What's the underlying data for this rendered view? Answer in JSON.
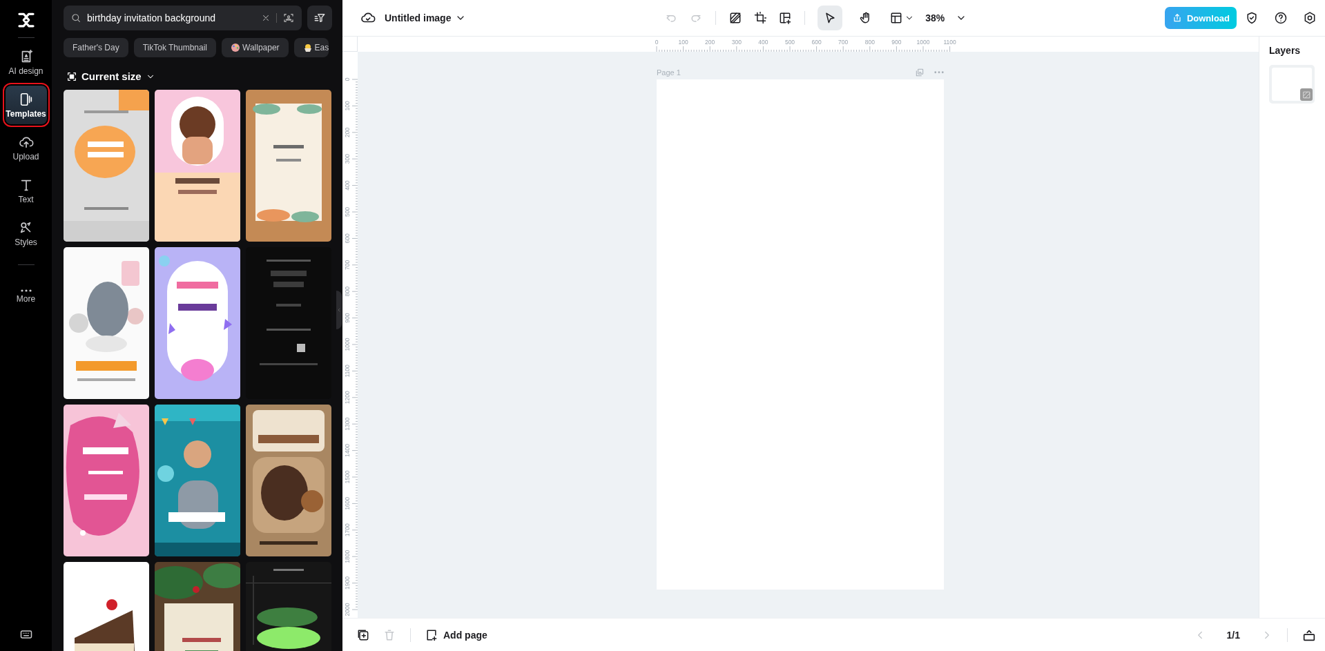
{
  "rail": {
    "items": [
      {
        "label": "AI design",
        "selected": false
      },
      {
        "label": "Templates",
        "selected": true
      },
      {
        "label": "Upload",
        "selected": false
      },
      {
        "label": "Text",
        "selected": false
      },
      {
        "label": "Styles",
        "selected": false
      },
      {
        "label": "More",
        "selected": false
      }
    ]
  },
  "search": {
    "value": "birthday invitation background"
  },
  "chips": [
    {
      "label": "Father's Day",
      "kind": "plain"
    },
    {
      "label": "TikTok Thumbnail",
      "kind": "plain"
    },
    {
      "label": "Wallpaper",
      "kind": "palette"
    },
    {
      "label": "Eas",
      "kind": "chick"
    }
  ],
  "section": {
    "title": "Current size"
  },
  "topbar": {
    "title": "Untitled image",
    "undo_disabled": true,
    "redo_disabled": true,
    "zoom": "38%",
    "download": "Download"
  },
  "tools": [
    {
      "kind": "select",
      "selected": true
    },
    {
      "kind": "hand",
      "selected": false
    }
  ],
  "ruler": {
    "x_labels": [
      "0",
      "100",
      "200",
      "300",
      "400",
      "500",
      "600",
      "700",
      "800",
      "900",
      "1000",
      "1100"
    ],
    "y_labels": [
      "0",
      "100",
      "200",
      "300",
      "400",
      "500",
      "600",
      "700",
      "800",
      "900",
      "1000",
      "1100",
      "1200",
      "1300",
      "1400",
      "1500",
      "1600",
      "1700",
      "1800",
      "1900",
      "2000"
    ]
  },
  "page": {
    "label": "Page 1"
  },
  "layers": {
    "title": "Layers"
  },
  "footer": {
    "delete_disabled": true,
    "add_page": "Add page",
    "prev_disabled": true,
    "page_count": "1/1",
    "next_disabled": true
  }
}
